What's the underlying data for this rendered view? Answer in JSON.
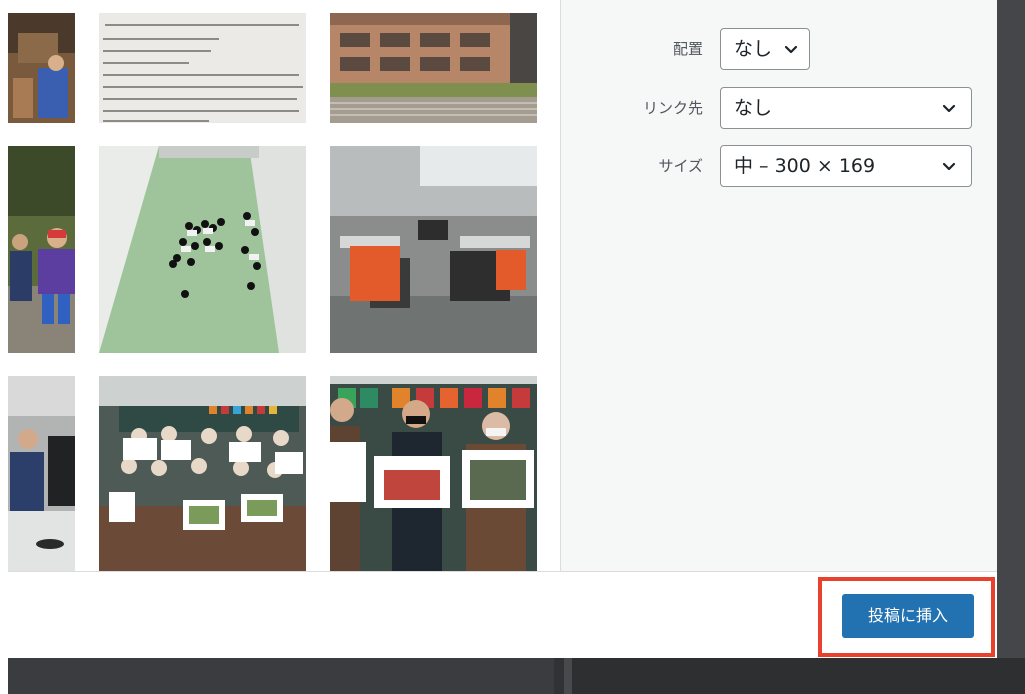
{
  "attachment_settings": {
    "alignment": {
      "label": "配置",
      "value": "なし"
    },
    "link_to": {
      "label": "リンク先",
      "value": "なし"
    },
    "size": {
      "label": "サイズ",
      "value": "中 – 300 × 169"
    }
  },
  "footer": {
    "insert_label": "投稿に挿入"
  },
  "colors": {
    "primary_button": "#2271b1",
    "highlight_outline": "#e8412e",
    "sidebar_background": "#f6f7f7",
    "backdrop": "#3b3d40"
  },
  "icons": {
    "select_arrow": "chevron-down-icon"
  }
}
